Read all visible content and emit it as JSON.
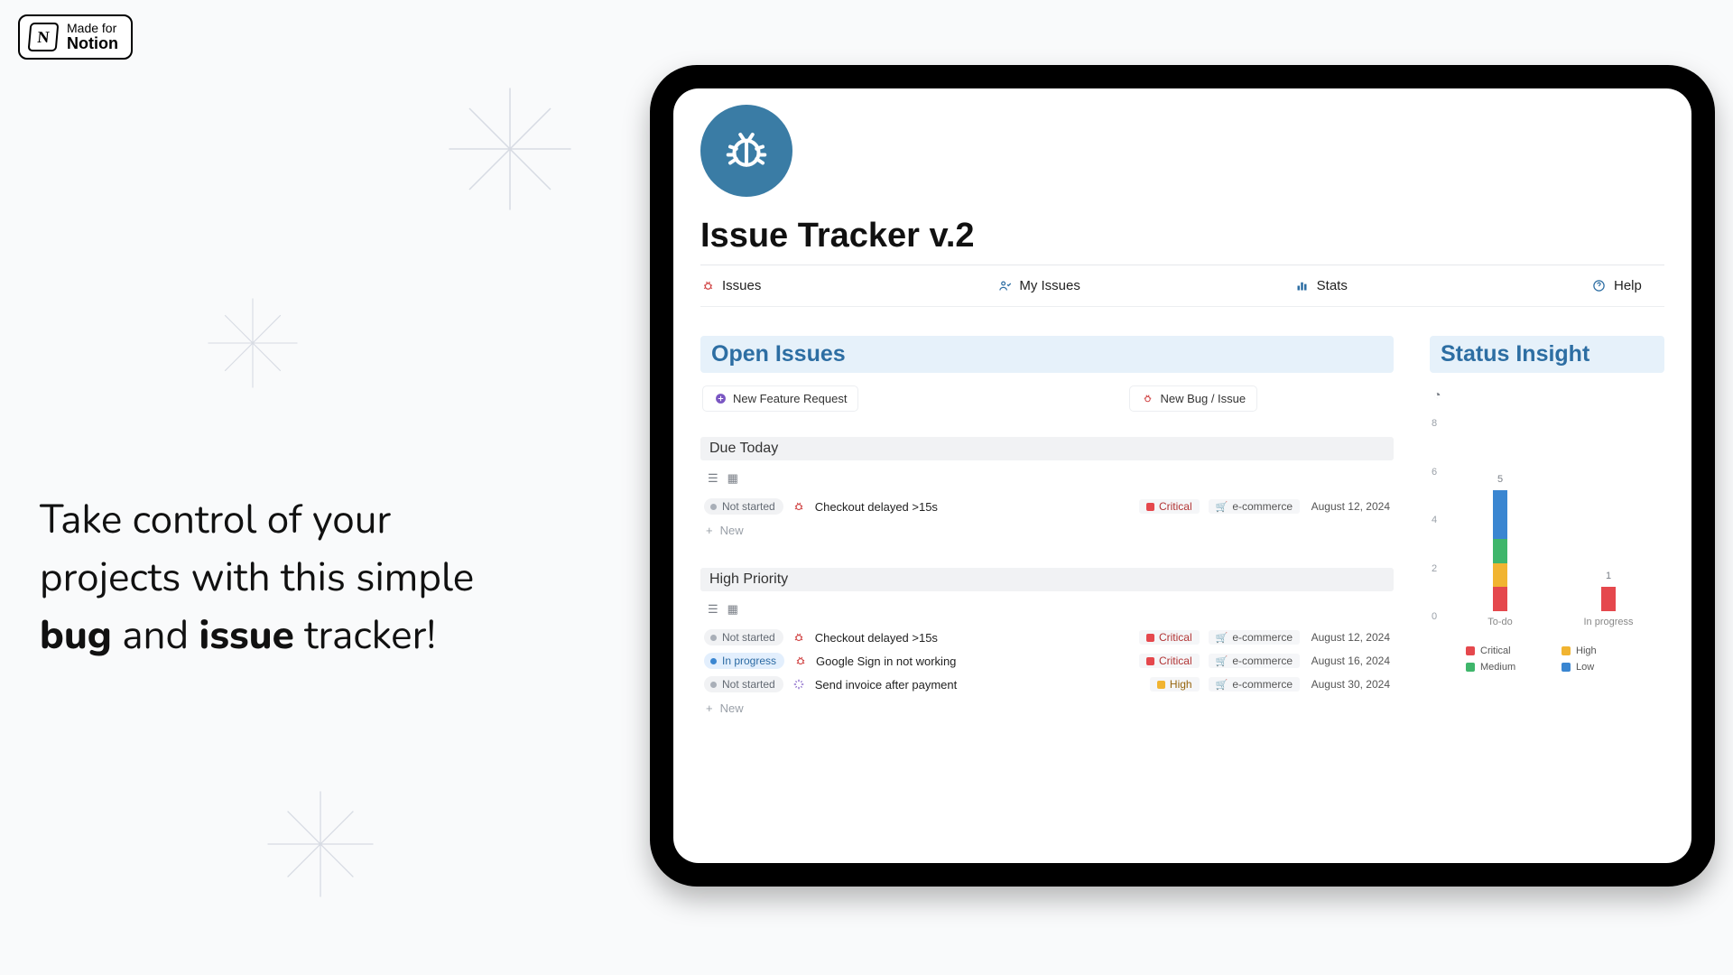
{
  "badge": {
    "made_for": "Made for",
    "notion": "Notion",
    "logo_letter": "N"
  },
  "tagline": {
    "t1": "Take control of your",
    "t2": "projects with this simple",
    "t3a": "bug",
    "t3b": " and ",
    "t3c": "issue",
    "t3d": " tracker!"
  },
  "page": {
    "title": "Issue Tracker v.2"
  },
  "nav": {
    "issues": "Issues",
    "my_issues": "My Issues",
    "stats": "Stats",
    "help": "Help"
  },
  "sections": {
    "open_issues": "Open Issues",
    "status_insight": "Status Insight"
  },
  "buttons": {
    "new_feature": "New Feature Request",
    "new_bug": "New Bug / Issue",
    "add_new": "New"
  },
  "blocks": {
    "due_today": "Due Today",
    "high_priority": "High Priority"
  },
  "status": {
    "not_started": "Not started",
    "in_progress": "In progress"
  },
  "priority": {
    "critical": "Critical",
    "high": "High"
  },
  "category": {
    "ecommerce": "e-commerce"
  },
  "due_today_rows": [
    {
      "status": "not_started",
      "icon": "bug",
      "title": "Checkout delayed >15s",
      "priority": "critical",
      "category": "ecommerce",
      "date": "August 12, 2024"
    }
  ],
  "high_priority_rows": [
    {
      "status": "not_started",
      "icon": "bug",
      "title": "Checkout delayed >15s",
      "priority": "critical",
      "category": "ecommerce",
      "date": "August 12, 2024"
    },
    {
      "status": "in_progress",
      "icon": "bug",
      "title": "Google Sign in not working",
      "priority": "critical",
      "category": "ecommerce",
      "date": "August 16, 2024"
    },
    {
      "status": "not_started",
      "icon": "sparkle",
      "title": "Send invoice after payment",
      "priority": "high",
      "category": "ecommerce",
      "date": "August 30, 2024"
    }
  ],
  "chart_data": {
    "type": "bar",
    "categories": [
      "To-do",
      "In progress"
    ],
    "ylim": [
      0,
      8
    ],
    "yticks": [
      0,
      2,
      4,
      6,
      8
    ],
    "series": [
      {
        "name": "Critical",
        "color": "#e5484d",
        "values": [
          1,
          1
        ]
      },
      {
        "name": "High",
        "color": "#f1b431",
        "values": [
          1,
          0
        ]
      },
      {
        "name": "Medium",
        "color": "#3fb66b",
        "values": [
          1,
          0
        ]
      },
      {
        "name": "Low",
        "color": "#3a86d1",
        "values": [
          2,
          0
        ]
      }
    ],
    "totals": [
      5,
      1
    ],
    "legend": [
      "Critical",
      "High",
      "Medium",
      "Low"
    ]
  }
}
